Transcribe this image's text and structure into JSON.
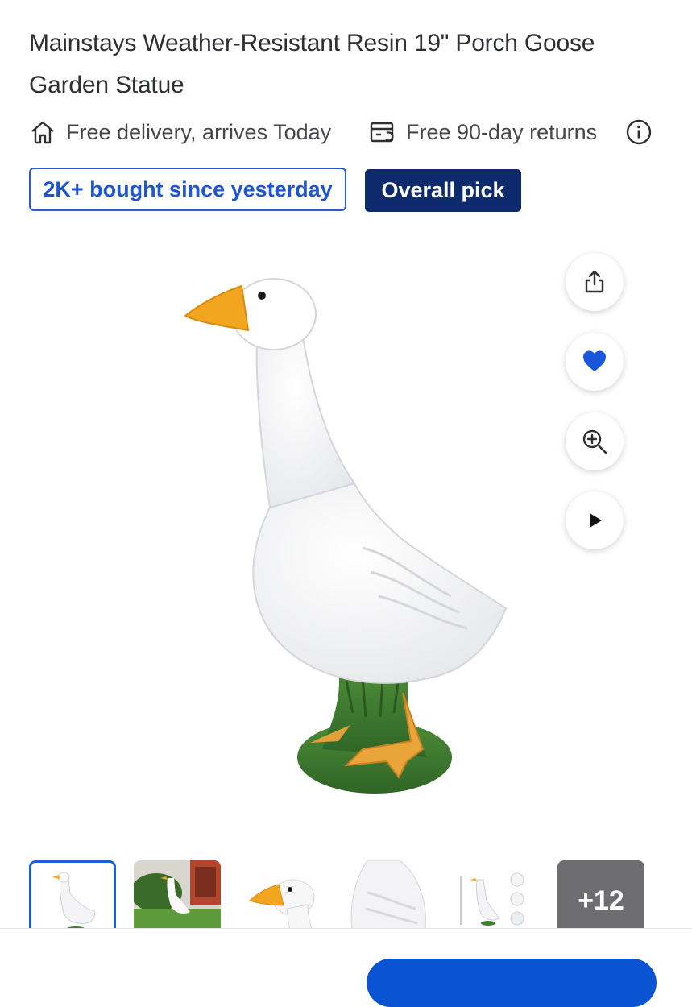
{
  "product": {
    "title_line1": "Mainstays Weather-Resistant Resin 19\" Porch Goose",
    "title_line2": "Garden Statue"
  },
  "delivery": {
    "icon": "house-icon",
    "text": "Free delivery, arrives Today"
  },
  "returns": {
    "icon": "return-box-icon",
    "text": "Free 90-day returns"
  },
  "badges": {
    "bought": "2K+ bought since yesterday",
    "pick": "Overall pick"
  },
  "actions": {
    "icons": [
      "share-icon",
      "heart-icon",
      "zoom-in-icon",
      "play-icon"
    ]
  },
  "thumbnails": {
    "more_label": "+12"
  },
  "colors": {
    "accent_blue": "#1f55d0",
    "badge_dark": "#0d2a6d",
    "beak_orange": "#f2a51f",
    "base_green": "#3f7d2f"
  }
}
